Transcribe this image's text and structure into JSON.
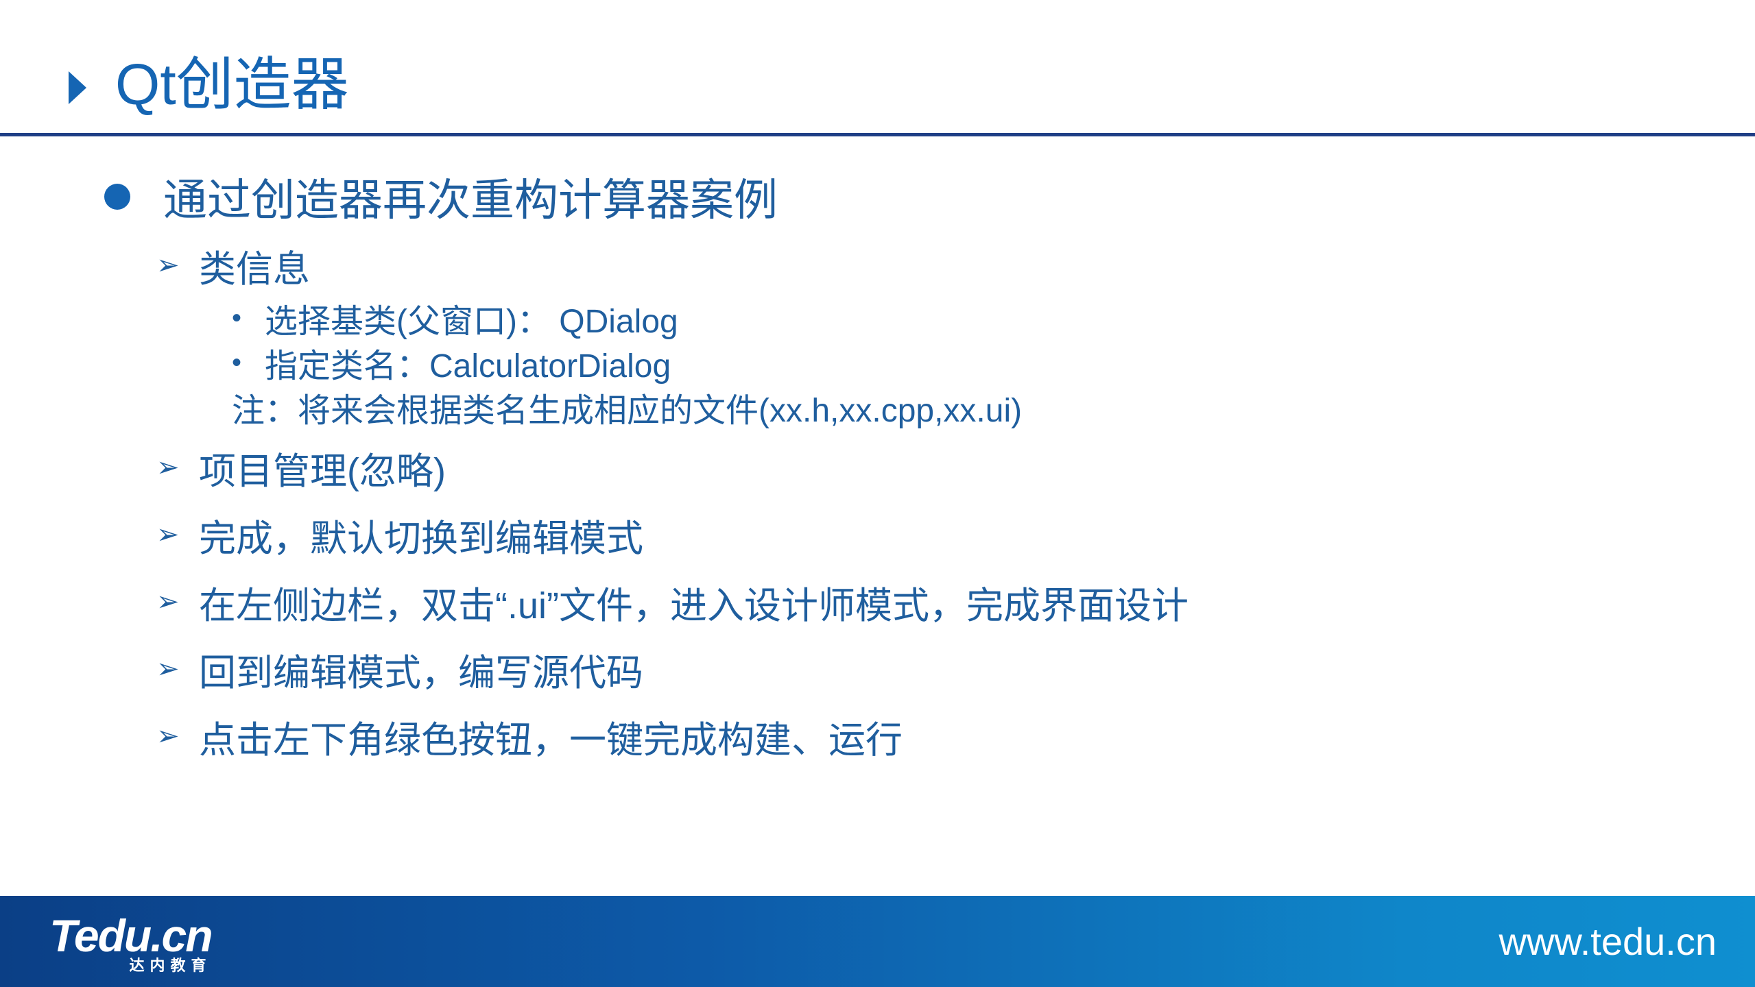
{
  "slide": {
    "title": "Qt创造器",
    "main_point": "通过创造器再次重构计算器案例",
    "steps": [
      {
        "label": "类信息",
        "sub_items": [
          "选择基类(父窗口)： QDialog",
          "指定类名：CalculatorDialog"
        ],
        "note": "注：将来会根据类名生成相应的文件(xx.h,xx.cpp,xx.ui)"
      },
      {
        "label": "项目管理(忽略)"
      },
      {
        "label": "完成，默认切换到编辑模式"
      },
      {
        "label": "在左侧边栏，双击“.ui”文件，进入设计师模式，完成界面设计"
      },
      {
        "label": "回到编辑模式，编写源代码"
      },
      {
        "label": "点击左下角绿色按钮，一键完成构建、运行"
      }
    ]
  },
  "footer": {
    "logo_text": "Tedu.cn",
    "logo_subtitle": "达内教育",
    "website": "www.tedu.cn"
  },
  "icons": {
    "title_marker": "triangle-right-icon",
    "main_bullet": "filled-circle-icon",
    "step_bullet": "arrowhead-bullet-icon",
    "sub_bullet": "small-dot-icon"
  },
  "colors": {
    "title": "#1565b3",
    "text": "#1f5e9e",
    "rule": "#1f3f86",
    "footer_start": "#0b3f86",
    "footer_end": "#0f8fd0"
  }
}
